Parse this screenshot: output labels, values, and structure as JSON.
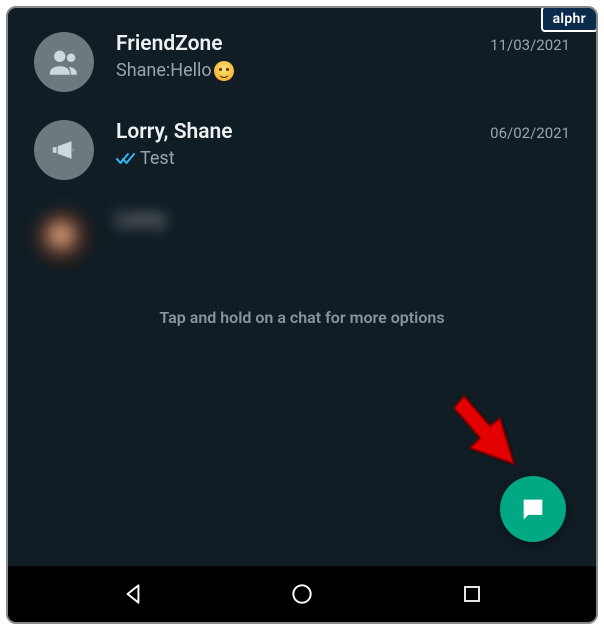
{
  "badge": "alphr",
  "chats": [
    {
      "title": "FriendZone",
      "preview_prefix": "Shane: ",
      "preview_text": "Hello",
      "date": "11/03/2021",
      "avatar_type": "group",
      "has_emoji": true,
      "has_ticks": false
    },
    {
      "title": "Lorry, Shane",
      "preview_prefix": "",
      "preview_text": "Test",
      "date": "06/02/2021",
      "avatar_type": "broadcast",
      "has_emoji": false,
      "has_ticks": true
    },
    {
      "title": "Lorry",
      "preview_prefix": "",
      "preview_text": "",
      "date": "",
      "avatar_type": "photo",
      "has_emoji": false,
      "has_ticks": false,
      "blurred": true
    }
  ],
  "hint": "Tap and hold on a chat for more options",
  "colors": {
    "accent": "#00a884",
    "tick": "#34b7f1"
  }
}
